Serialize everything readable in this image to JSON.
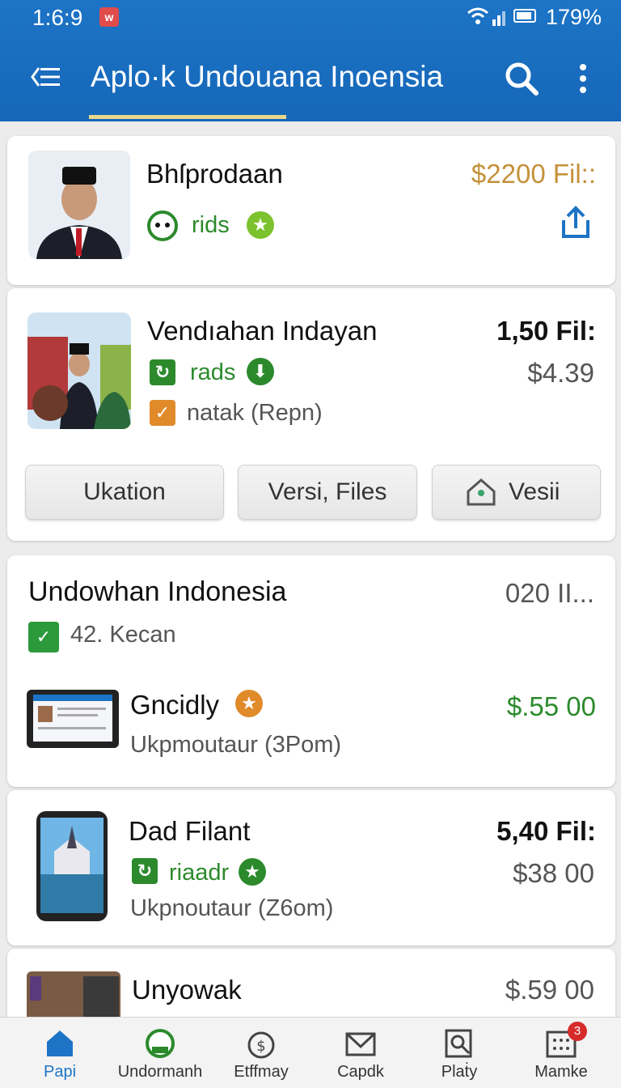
{
  "status_bar": {
    "time": "1:6:9",
    "notification_glyph": "w",
    "battery": "179%"
  },
  "app_bar": {
    "title": "Aplo·k Undouana Inoensia",
    "menu_icon": "menu-icon",
    "search_icon": "search-icon",
    "more_icon": "more-vert-icon"
  },
  "items": [
    {
      "name": "Bhſprodaan",
      "rating_label": "rids",
      "price": "$2200 Fil::",
      "price_color": "#c5913a"
    },
    {
      "name": "Vendıahan Indayan",
      "rating_label": "rads",
      "info": "natak (Repn)",
      "price": "1,50 Fil:",
      "sub_price": "$4.39",
      "actions": [
        "Ukation",
        "Versi, Files",
        "Vesii"
      ]
    },
    {
      "name": "Undowhan Indonesia",
      "info": "42. Kecan",
      "price": "020 II..."
    },
    {
      "name": "Gncidly",
      "info": "Ukpmoutaur (3Pom)",
      "price": "$.55 00",
      "price_color": "#2c8a2c"
    },
    {
      "name": "Dad Filant",
      "rating_label": "riaadr",
      "info": "Ukpnoutaur (Z6om)",
      "price": "5,40 Fil:",
      "sub_price": "$38 00"
    },
    {
      "name": "Unyowak",
      "price": "$.59 00"
    }
  ],
  "bottom_nav": [
    {
      "label": "Papi",
      "icon": "home-icon",
      "active": true
    },
    {
      "label": "Undormanh",
      "icon": "circle-icon"
    },
    {
      "label": "Etffmay",
      "icon": "dollar-icon"
    },
    {
      "label": "Capdk",
      "icon": "mail-icon"
    },
    {
      "label": "Plaṫy",
      "icon": "search-doc-icon"
    },
    {
      "label": "Mamke",
      "icon": "grid-icon",
      "badge": "3"
    }
  ],
  "colors": {
    "primary": "#1d74c6",
    "accent_green": "#2c8a2c",
    "gold": "#c5913a"
  }
}
